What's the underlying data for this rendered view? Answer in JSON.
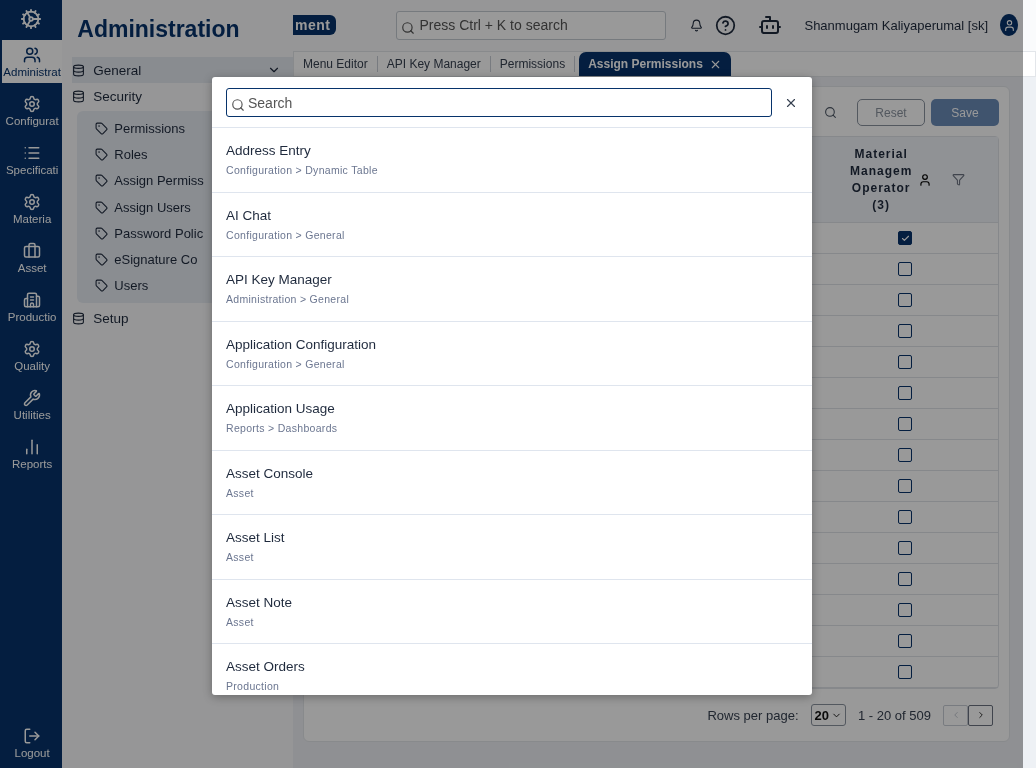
{
  "rail": {
    "items": [
      {
        "label": "Administrat",
        "selected": true
      },
      {
        "label": "Configurat",
        "selected": false
      },
      {
        "label": "Specificati",
        "selected": false
      },
      {
        "label": "Materia",
        "selected": false
      },
      {
        "label": "Asset",
        "selected": false
      },
      {
        "label": "Productio",
        "selected": false
      },
      {
        "label": "Quality",
        "selected": false
      },
      {
        "label": "Utilities",
        "selected": false
      },
      {
        "label": "Reports",
        "selected": false
      }
    ],
    "logout": "Logout"
  },
  "nav_panel": {
    "title": "Administration",
    "tree": [
      {
        "label": "General",
        "hovered": true
      },
      {
        "label": "Security",
        "hovered": false,
        "children": [
          {
            "label": "Permissions"
          },
          {
            "label": "Roles"
          },
          {
            "label": "Assign Permiss"
          },
          {
            "label": "Assign Users"
          },
          {
            "label": "Password Polic"
          },
          {
            "label": "eSignature Co"
          },
          {
            "label": "Users"
          }
        ]
      },
      {
        "label": "Setup",
        "hovered": false
      }
    ]
  },
  "header": {
    "badge": "ment",
    "search_placeholder": "Press Ctrl + K to search",
    "user": "Shanmugam Kaliyaperumal [sk]"
  },
  "tabs": [
    {
      "label": "Menu Editor",
      "selected": false
    },
    {
      "label": "API Key Manager",
      "selected": false
    },
    {
      "label": "Permissions",
      "selected": false
    },
    {
      "label": "Assign Permissions",
      "selected": true
    }
  ],
  "toolbar": {
    "reset": "Reset",
    "save": "Save"
  },
  "table": {
    "column_header": "Material Managem Operator (3)",
    "rows": [
      {
        "checked": true
      },
      {
        "checked": false
      },
      {
        "checked": false
      },
      {
        "checked": false
      },
      {
        "checked": false
      },
      {
        "checked": false
      },
      {
        "checked": false
      },
      {
        "checked": false
      },
      {
        "checked": false
      },
      {
        "checked": false
      },
      {
        "checked": false
      },
      {
        "checked": false
      },
      {
        "checked": false
      },
      {
        "checked": false
      },
      {
        "checked": false
      }
    ]
  },
  "pagination": {
    "rows_label": "Rows per page:",
    "rows_value": "20",
    "range": "1 - 20 of 509",
    "prev_disabled": true,
    "next_disabled": false
  },
  "modal": {
    "search_placeholder": "Search",
    "results": [
      {
        "title": "Address Entry",
        "path": "Configuration > Dynamic Table"
      },
      {
        "title": "AI Chat",
        "path": "Configuration > General"
      },
      {
        "title": "API Key Manager",
        "path": "Administration > General"
      },
      {
        "title": "Application Configuration",
        "path": "Configuration > General"
      },
      {
        "title": "Application Usage",
        "path": "Reports > Dashboards"
      },
      {
        "title": "Asset Console",
        "path": "Asset"
      },
      {
        "title": "Asset List",
        "path": "Asset"
      },
      {
        "title": "Asset Note",
        "path": "Asset"
      },
      {
        "title": "Asset Orders",
        "path": "Production"
      }
    ]
  }
}
